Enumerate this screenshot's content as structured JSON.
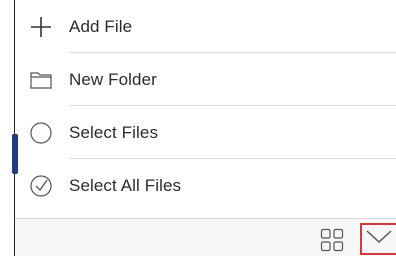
{
  "menu": {
    "items": [
      {
        "label": "Add File",
        "icon": "plus-icon"
      },
      {
        "label": "New Folder",
        "icon": "folder-icon"
      },
      {
        "label": "Select Files",
        "icon": "circle-icon"
      },
      {
        "label": "Select All Files",
        "icon": "check-circle-icon"
      }
    ]
  },
  "toolbar": {
    "grid_icon": "grid-view-icon",
    "chevron_icon": "chevron-down-icon",
    "highlight_color": "#d03a3a"
  },
  "colors": {
    "text": "#2b2b2b",
    "separator": "#dcdcdc",
    "handle": "#1f3c74"
  }
}
